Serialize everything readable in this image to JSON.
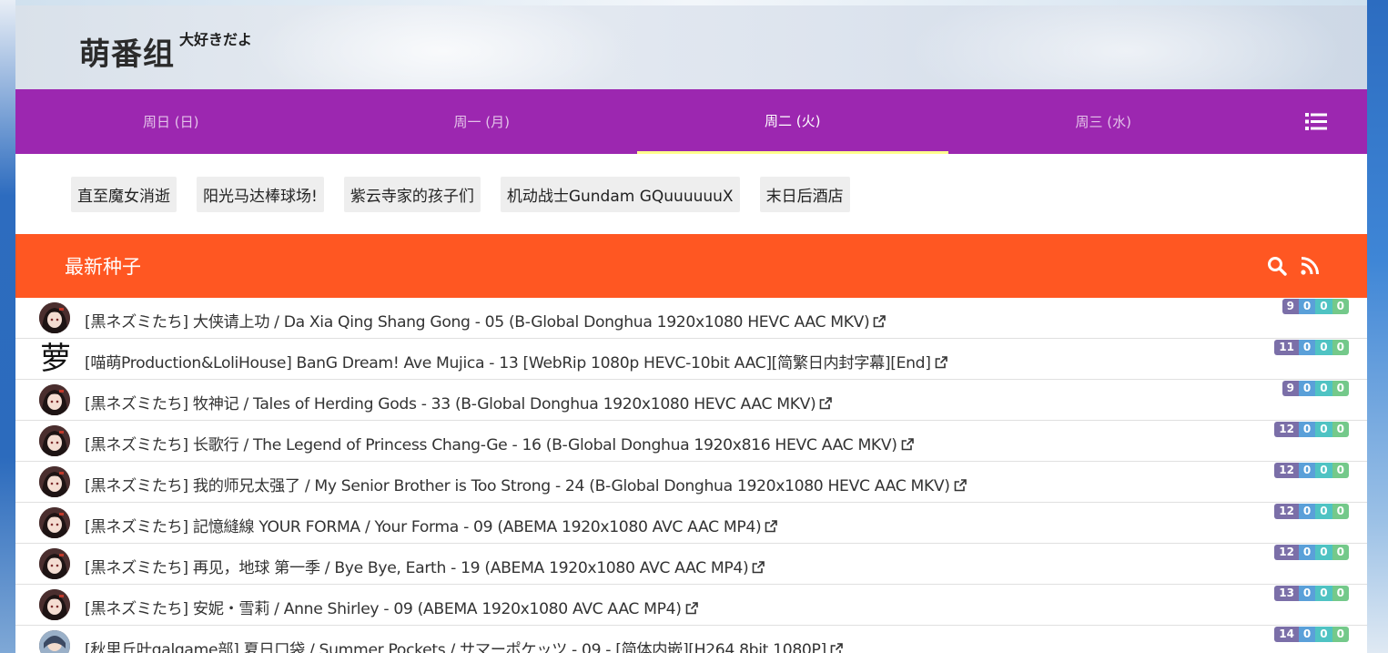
{
  "site": {
    "logo": "萌番组",
    "logo_sub": "大好きだよ"
  },
  "days": [
    {
      "label": "周日 (日)",
      "active": false
    },
    {
      "label": "周一 (月)",
      "active": false
    },
    {
      "label": "周二 (火)",
      "active": true
    },
    {
      "label": "周三 (水)",
      "active": false
    }
  ],
  "bangumi": [
    "直至魔女消逝",
    "阳光马达棒球场!",
    "紫云寺家的孩子们",
    "机动战士Gundam GQuuuuuuX",
    "末日后酒店"
  ],
  "latest": {
    "title": "最新种子"
  },
  "torrents": [
    {
      "avatar": "img",
      "avatar_text": "",
      "title": "[黒ネズミたち] 大侠请上功 / Da Xia Qing Shang Gong - 05 (B-Global Donghua 1920x1080 HEVC AAC MKV)",
      "size": "9",
      "seed": "0",
      "leech": "0",
      "done": "0"
    },
    {
      "avatar": "text",
      "avatar_text": "萝",
      "title": "[喵萌Production&LoliHouse] BanG Dream! Ave Mujica - 13 [WebRip 1080p HEVC-10bit AAC][简繁日内封字幕][End]",
      "size": "11",
      "seed": "0",
      "leech": "0",
      "done": "0"
    },
    {
      "avatar": "img",
      "avatar_text": "",
      "title": "[黒ネズミたち] 牧神记 / Tales of Herding Gods - 33 (B-Global Donghua 1920x1080 HEVC AAC MKV)",
      "size": "9",
      "seed": "0",
      "leech": "0",
      "done": "0"
    },
    {
      "avatar": "img",
      "avatar_text": "",
      "title": "[黒ネズミたち] 长歌行 / The Legend of Princess Chang-Ge - 16 (B-Global Donghua 1920x816 HEVC AAC MKV)",
      "size": "12",
      "seed": "0",
      "leech": "0",
      "done": "0"
    },
    {
      "avatar": "img",
      "avatar_text": "",
      "title": "[黒ネズミたち] 我的师兄太强了 / My Senior Brother is Too Strong - 24 (B-Global Donghua 1920x1080 HEVC AAC MKV)",
      "size": "12",
      "seed": "0",
      "leech": "0",
      "done": "0"
    },
    {
      "avatar": "img",
      "avatar_text": "",
      "title": "[黒ネズミたち] 記憶縫線 YOUR FORMA / Your Forma - 09 (ABEMA 1920x1080 AVC AAC MP4)",
      "size": "12",
      "seed": "0",
      "leech": "0",
      "done": "0"
    },
    {
      "avatar": "img",
      "avatar_text": "",
      "title": "[黒ネズミたち] 再见，地球 第一季 / Bye Bye, Earth - 19 (ABEMA 1920x1080 AVC AAC MP4)",
      "size": "12",
      "seed": "0",
      "leech": "0",
      "done": "0"
    },
    {
      "avatar": "img",
      "avatar_text": "",
      "title": "[黒ネズミたち] 安妮・雪莉 / Anne Shirley - 09 (ABEMA 1920x1080 AVC AAC MP4)",
      "size": "13",
      "seed": "0",
      "leech": "0",
      "done": "0"
    },
    {
      "avatar": "img2",
      "avatar_text": "",
      "title": "[秋里丘叶galgame部] 夏日口袋 / Summer Pockets / サマーポケッツ - 09 - [简体内嵌][H264 8bit 1080P]",
      "size": "14",
      "seed": "0",
      "leech": "0",
      "done": "0"
    }
  ],
  "colors": {
    "nav": "#9c27b0",
    "nav_active_underline": "#ffff8d",
    "latest_bar": "#ff5722",
    "badge_size": "#7b6fa8",
    "badge_seed": "#5aa0d9",
    "badge_leech": "#4fc3c3",
    "badge_done": "#74c98a"
  },
  "icons": {
    "menu": "list-icon",
    "search": "search-icon",
    "rss": "rss-icon",
    "external": "external-link-icon"
  }
}
